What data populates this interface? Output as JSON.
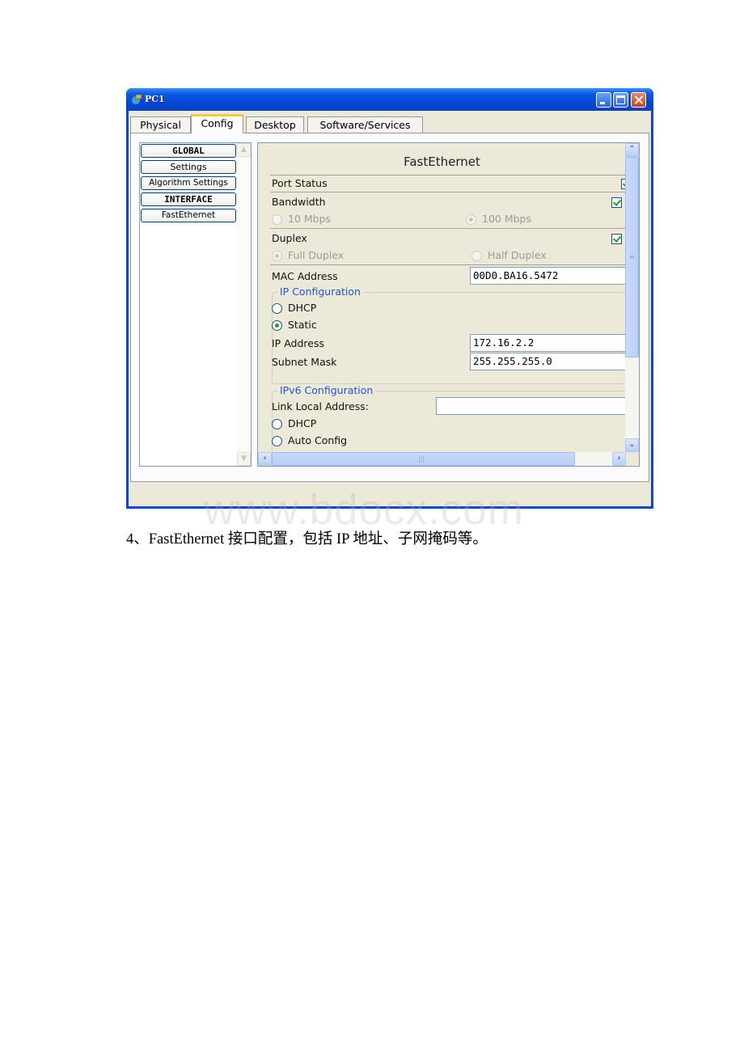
{
  "window": {
    "title": "PC1",
    "icon": "pc-globe-icon",
    "controls": [
      "minimize",
      "maximize",
      "close"
    ]
  },
  "tabs": [
    {
      "label": "Physical",
      "active": false
    },
    {
      "label": "Config",
      "active": true
    },
    {
      "label": "Desktop",
      "active": false
    },
    {
      "label": "Software/Services",
      "active": false
    }
  ],
  "sidebar": {
    "items": [
      {
        "label": "GLOBAL",
        "type": "header"
      },
      {
        "label": "Settings",
        "type": "item"
      },
      {
        "label": "Algorithm Settings",
        "type": "item"
      },
      {
        "label": "INTERFACE",
        "type": "header"
      },
      {
        "label": "FastEthernet",
        "type": "item",
        "selected": true
      }
    ]
  },
  "panel": {
    "title": "FastEthernet",
    "port_status": {
      "label": "Port Status",
      "checked": true
    },
    "bandwidth": {
      "label": "Bandwidth",
      "auto_checked": true,
      "options": [
        {
          "label": "10 Mbps",
          "selected": false
        },
        {
          "label": "100 Mbps",
          "selected": true
        }
      ]
    },
    "duplex": {
      "label": "Duplex",
      "auto_checked": true,
      "options": [
        {
          "label": "Full Duplex",
          "selected": true
        },
        {
          "label": "Half Duplex",
          "selected": false
        }
      ]
    },
    "mac": {
      "label": "MAC Address",
      "value": "00D0.BA16.5472"
    },
    "ip_config": {
      "legend": "IP Configuration",
      "dhcp_label": "DHCP",
      "static_label": "Static",
      "mode": "Static",
      "ip_label": "IP Address",
      "ip_value": "172.16.2.2",
      "mask_label": "Subnet Mask",
      "mask_value": "255.255.255.0"
    },
    "ipv6_config": {
      "legend": "IPv6 Configuration",
      "link_local_label": "Link Local Address:",
      "link_local_value": "",
      "dhcp_label": "DHCP",
      "auto_label": "Auto Config"
    }
  },
  "document": {
    "caption": "4、FastEthernet 接口配置，包括 IP 地址、子网掩码等。",
    "watermark": "www.bdocx.com"
  }
}
